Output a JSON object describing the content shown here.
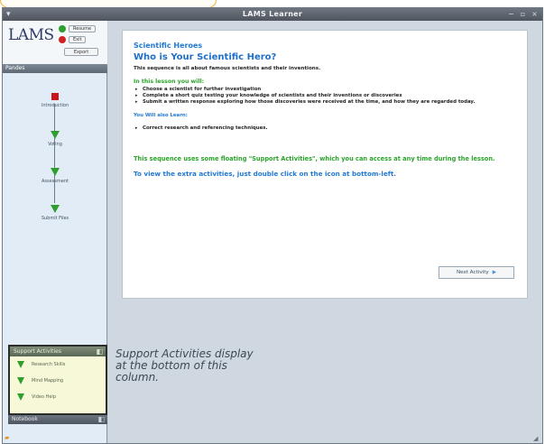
{
  "window": {
    "title": "LAMS Learner",
    "app_icon": "▾",
    "controls": [
      "−",
      "▫",
      "×"
    ]
  },
  "logo": {
    "text": "LAMS"
  },
  "controls": {
    "resume": "Resume",
    "exit": "Exit",
    "export": "Export"
  },
  "sequence": {
    "header": "Pandes",
    "items": [
      {
        "label": "Introduction",
        "icon": "square-icon",
        "status": "current"
      },
      {
        "label": "Voting",
        "icon": "triangle-icon",
        "status": "not-started"
      },
      {
        "label": "Assessment",
        "icon": "triangle-icon",
        "status": "not-started"
      },
      {
        "label": "Submit Files",
        "icon": "triangle-icon",
        "status": "not-started"
      }
    ]
  },
  "support": {
    "header": "Support Activities",
    "items": [
      "Research Skills",
      "Mind Mapping",
      "Video Help"
    ]
  },
  "notebook": {
    "label": "Notebook"
  },
  "content": {
    "breadcrumb": "Scientific Heroes",
    "heading": "Who is Your Scientific Hero?",
    "intro": "This sequence is all about famous scientists and their inventions.",
    "lesson_head": "In this lesson you will:",
    "bullets": [
      "Choose a scientist for further investigation",
      "Complete a short quiz testing your knowledge of scientists and their inventions or discoveries",
      "Submit a written response exploring how those discoveries were received at the time, and how they are regarded today."
    ],
    "also_learn_head": "You Will also Learn:",
    "also_learn_bullets": [
      "Correct research and referencing techniques."
    ],
    "support_para": "This sequence uses some floating \"Support Activities\", which you can access at any time during the lesson.",
    "extra_para": "To view the extra activities, just double click on the icon at bottom-left.",
    "next_button": "Next Activity"
  },
  "note": "Support Activities display at the bottom of this column.",
  "colors": {
    "accent_blue": "#2079d3",
    "accent_green": "#2aa42a",
    "current_red": "#c9141c"
  }
}
